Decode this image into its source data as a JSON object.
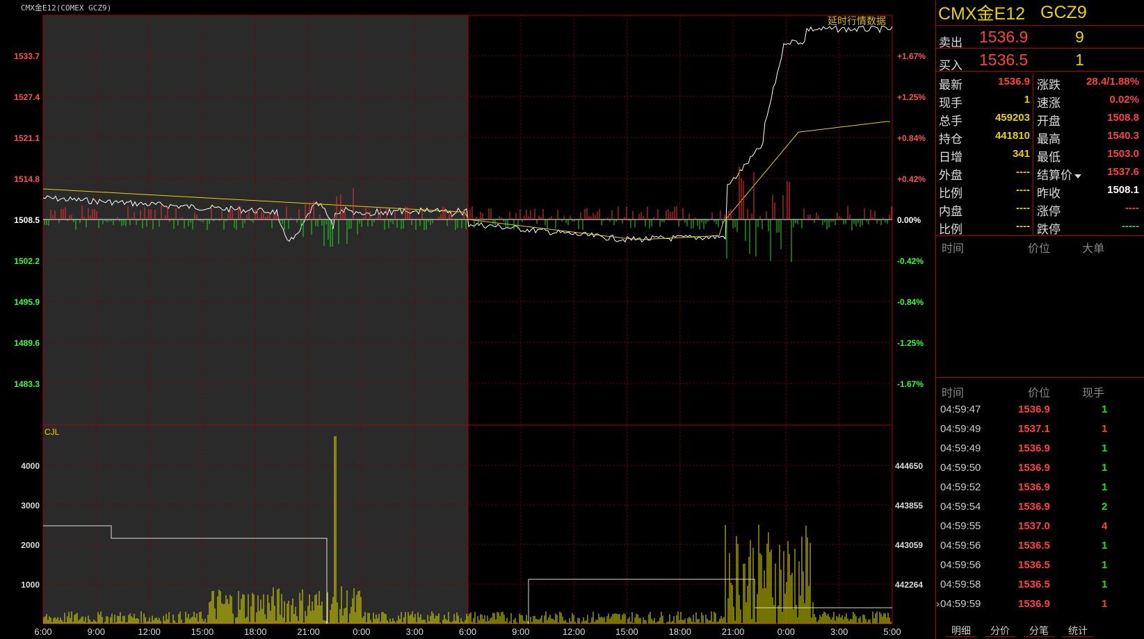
{
  "chart": {
    "title_tag": "CMX金E12(COMEX GCZ9)",
    "delay_tag": "延时行情数据",
    "cjl_label": "CJL",
    "price_axis_left": [
      "1533.7",
      "1527.4",
      "1521.1",
      "1514.8",
      "1508.5",
      "1502.2",
      "1495.9",
      "1489.6",
      "1483.3"
    ],
    "pct_axis_right": [
      "+1.67%",
      "+1.25%",
      "+0.84%",
      "+0.42%",
      "0.00%",
      "-0.42%",
      "-0.84%",
      "-1.25%",
      "-1.67%"
    ],
    "vol_axis_left": [
      "4000",
      "3000",
      "2000",
      "1000"
    ],
    "vol_axis_right": [
      "444650",
      "443855",
      "443059",
      "442264"
    ],
    "time_axis": [
      "6:00",
      "9:00",
      "12:00",
      "15:00",
      "18:00",
      "21:00",
      "0:00",
      "3:00",
      "6:00",
      "9:00",
      "12:00",
      "15:00",
      "18:00",
      "21:00",
      "0:00",
      "3:00",
      "5:00"
    ],
    "colors": {
      "up": "#ff3030",
      "down": "#20e020",
      "price_line": "#ffffff",
      "avg_line": "#e8d200",
      "grid": "#7a0000",
      "history_bg": "#2a2a2a"
    }
  },
  "panel": {
    "name": "CMX金E12",
    "code": "GCZ9",
    "ask": {
      "label": "卖出",
      "price": "1536.9",
      "qty": "9"
    },
    "bid": {
      "label": "买入",
      "price": "1536.5",
      "qty": "1"
    },
    "stats": [
      {
        "l1": "最新",
        "v1": "1536.9",
        "c1": "red",
        "l2": "涨跌",
        "v2": "28.4/1.88%",
        "c2": "red"
      },
      {
        "l1": "现手",
        "v1": "1",
        "c1": "yel",
        "l2": "速涨",
        "v2": "0.02%",
        "c2": "red"
      },
      {
        "l1": "总手",
        "v1": "459203",
        "c1": "yel",
        "l2": "开盘",
        "v2": "1508.8",
        "c2": "red"
      },
      {
        "l1": "持仓",
        "v1": "441810",
        "c1": "yel",
        "l2": "最高",
        "v2": "1540.3",
        "c2": "red"
      },
      {
        "l1": "日增",
        "v1": "341",
        "c1": "yel",
        "l2": "最低",
        "v2": "1503.0",
        "c2": "red"
      },
      {
        "l1": "外盘",
        "v1": "----",
        "c1": "yel",
        "l2": "结算价",
        "v2": "1537.6",
        "c2": "red"
      },
      {
        "l1": "比例",
        "v1": "----",
        "c1": "yel",
        "l2": "昨收",
        "v2": "1508.1",
        "c2": "wht"
      },
      {
        "l1": "内盘",
        "v1": "----",
        "c1": "yel",
        "l2": "涨停",
        "v2": "----",
        "c2": "red"
      },
      {
        "l1": "比例",
        "v1": "----",
        "c1": "yel",
        "l2": "跌停",
        "v2": "-----",
        "c2": "grn"
      }
    ],
    "big_header": {
      "time": "时间",
      "price": "价位",
      "big": "大单"
    },
    "tick_header": {
      "time": "时间",
      "price": "价位",
      "qty": "现手"
    },
    "ticks": [
      {
        "t": "04:59:47",
        "p": "1536.9",
        "q": "1",
        "c": "grn"
      },
      {
        "t": "04:59:49",
        "p": "1537.1",
        "q": "1",
        "c": "red"
      },
      {
        "t": "04:59:49",
        "p": "1536.9",
        "q": "1",
        "c": "grn"
      },
      {
        "t": "04:59:50",
        "p": "1536.9",
        "q": "1",
        "c": "grn"
      },
      {
        "t": "04:59:52",
        "p": "1536.9",
        "q": "1",
        "c": "grn"
      },
      {
        "t": "04:59:54",
        "p": "1536.9",
        "q": "2",
        "c": "grn"
      },
      {
        "t": "04:59:55",
        "p": "1537.0",
        "q": "4",
        "c": "red"
      },
      {
        "t": "04:59:56",
        "p": "1536.5",
        "q": "1",
        "c": "grn"
      },
      {
        "t": "04:59:56",
        "p": "1536.5",
        "q": "1",
        "c": "grn"
      },
      {
        "t": "04:59:58",
        "p": "1536.5",
        "q": "1",
        "c": "grn"
      },
      {
        "t": "04:59:59",
        "p": "1536.9",
        "q": "1",
        "c": "red"
      }
    ],
    "tabs": [
      "明细",
      "分价",
      "分笔",
      "统计"
    ]
  }
}
